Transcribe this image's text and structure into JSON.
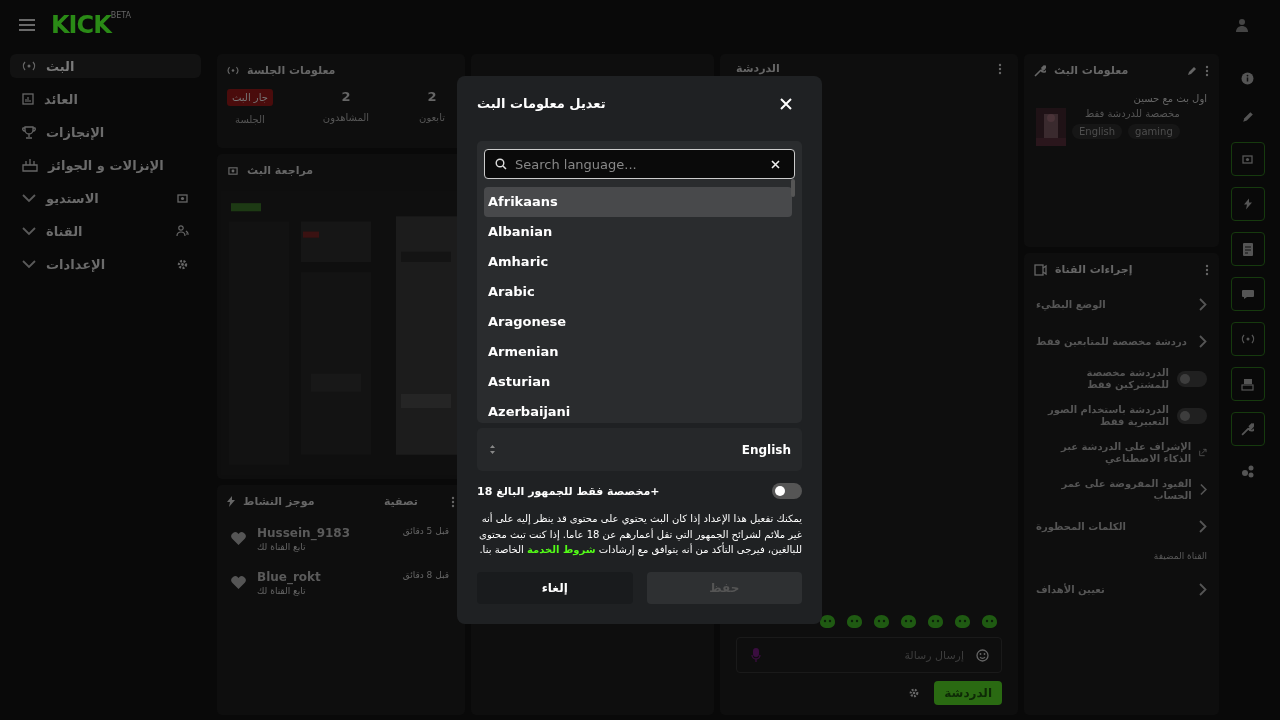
{
  "topbar": {
    "logo": "KICK",
    "logo_badge": "BETA"
  },
  "sidebar": {
    "items": [
      {
        "label": "البث",
        "kind": "link",
        "selected": true
      },
      {
        "label": "العائد",
        "kind": "link",
        "selected": false
      },
      {
        "label": "الإنجازات",
        "kind": "link",
        "selected": false
      },
      {
        "label": "الإنزالات و الجوائز",
        "kind": "link",
        "selected": false
      },
      {
        "label": "الاستديو",
        "kind": "group",
        "selected": false
      },
      {
        "label": "القناة",
        "kind": "group",
        "selected": false
      },
      {
        "label": "الإعدادات",
        "kind": "group",
        "selected": false
      }
    ]
  },
  "session": {
    "title": "معلومات الجلسة",
    "stats": [
      {
        "value": "2",
        "label": "تابعون",
        "kind": "number"
      },
      {
        "value": "2",
        "label": "المشاهدون",
        "kind": "number"
      },
      {
        "value": "جار البث",
        "label": "الجلسة",
        "kind": "badge"
      }
    ]
  },
  "review": {
    "title": "مراجعة البث"
  },
  "activity": {
    "title": "موجز النشاط",
    "filter": "تصفية",
    "items": [
      {
        "user": "Hussein_9183",
        "action": "تابع القناة لك",
        "time": "قبل 5 دقائق"
      },
      {
        "user": "Blue_rokt",
        "action": "تابع القناة لك",
        "time": "قبل 8 دقائق"
      }
    ]
  },
  "chat": {
    "title": "الدردشة",
    "placeholder": "إرسال رسالة",
    "send": "الدردشة"
  },
  "stream_info": {
    "title": "معلومات البث",
    "stream_title": "اول بث مع حسين",
    "category": "مخصصة للدردشة فقط",
    "tags": [
      "gaming",
      "English"
    ]
  },
  "channel_actions": {
    "title": "إجراءات القناة",
    "items": [
      {
        "label": "الوضع البطيء",
        "kind": "chevron"
      },
      {
        "label": "دردشة مخصصة للمتابعين فقط",
        "kind": "chevron"
      },
      {
        "label": "الدردشة مخصصة للمشتركين فقط",
        "kind": "toggle",
        "on": false
      },
      {
        "label": "الدردشة باستخدام الصور التعبيرية فقط",
        "kind": "toggle",
        "on": false
      },
      {
        "label": "الإشراف على الدردشة عبر الذكاء الاصطناعي",
        "kind": "external"
      },
      {
        "label": "القيود المفروضة على عمر الحساب",
        "kind": "chevron"
      },
      {
        "label": "الكلمات المحظورة",
        "kind": "chevron"
      },
      {
        "label": "القناة المضيفة",
        "kind": "section"
      },
      {
        "label": "تعيين الأهداف",
        "kind": "chevron"
      }
    ]
  },
  "rail": [
    {
      "boxed": false
    },
    {
      "boxed": false
    },
    {
      "boxed": true
    },
    {
      "boxed": true
    },
    {
      "boxed": true
    },
    {
      "boxed": true
    },
    {
      "boxed": true
    },
    {
      "boxed": true
    },
    {
      "boxed": true
    },
    {
      "boxed": false
    }
  ],
  "modal": {
    "title": "تعديل معلومات البث",
    "language_search": {
      "placeholder": "Search language..."
    },
    "languages": [
      {
        "label": "Afrikaans",
        "selected": true
      },
      {
        "label": "Albanian",
        "selected": false
      },
      {
        "label": "Amharic",
        "selected": false
      },
      {
        "label": "Arabic",
        "selected": false
      },
      {
        "label": "Aragonese",
        "selected": false
      },
      {
        "label": "Armenian",
        "selected": false
      },
      {
        "label": "Asturian",
        "selected": false
      },
      {
        "label": "Azerbaijani",
        "selected": false
      }
    ],
    "language_value": "English",
    "mature": {
      "label": "+مخصصة فقط للجمهور البالغ 18",
      "on": false
    },
    "notice": {
      "before": "يمكنك تفعيل هذا الإعداد إذا كان البث يحتوي على محتوى قد ينظر إليه على أنه غير ملائم لشرائح الجمهور التي تقل أعمارهم عن 18 عاما. إذا كنت تبث محتوى للبالغين، فيرجى التأكد من أنه يتوافق مع إرشادات",
      "link": "شروط الخدمة",
      "after": "الخاصة بنا."
    },
    "buttons": [
      {
        "label": "حفظ",
        "kind": "save",
        "disabled": true
      },
      {
        "label": "إلغاء",
        "kind": "cancel",
        "disabled": false
      }
    ]
  }
}
